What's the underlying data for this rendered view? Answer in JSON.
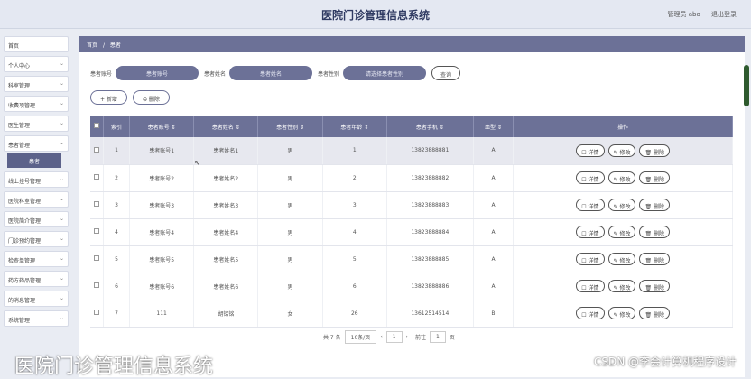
{
  "app": {
    "title": "医院门诊管理信息系统",
    "admin_label": "管理员 abo",
    "logout_label": "退出登录"
  },
  "sidebar": {
    "items": [
      {
        "label": "首页"
      },
      {
        "label": "个人中心"
      },
      {
        "label": "科室管理"
      },
      {
        "label": "收费项管理"
      },
      {
        "label": "医生管理"
      },
      {
        "label": "患者管理"
      },
      {
        "label": "线上挂号管理"
      },
      {
        "label": "医院科室管理"
      },
      {
        "label": "医院简介管理"
      },
      {
        "label": "门诊预约管理"
      },
      {
        "label": "检查单管理"
      },
      {
        "label": "药方药品管理"
      },
      {
        "label": "的消息管理"
      },
      {
        "label": "系统管理"
      }
    ],
    "active_sub": "患者"
  },
  "breadcrumb": {
    "home": "首页",
    "sep": "/",
    "current": "患者"
  },
  "filters": {
    "account_label": "患者账号",
    "account_placeholder": "患者账号",
    "name_label": "患者姓名",
    "name_placeholder": "患者姓名",
    "gender_label": "患者性别",
    "gender_placeholder": "请选择患者性别",
    "query_label": "查询"
  },
  "actions": {
    "add_label": "+ 新增",
    "delete_label": "⊖ 删除"
  },
  "table": {
    "headers": [
      "",
      "索引",
      "患者账号 ⇕",
      "患者姓名 ⇕",
      "患者性别 ⇕",
      "患者年龄 ⇕",
      "患者手机 ⇕",
      "血型 ⇕",
      "操作"
    ],
    "rows": [
      [
        "1",
        "患者账号1",
        "患者姓名1",
        "男",
        "1",
        "13823888881",
        "A"
      ],
      [
        "2",
        "患者账号2",
        "患者姓名2",
        "男",
        "2",
        "13823888882",
        "A"
      ],
      [
        "3",
        "患者账号3",
        "患者姓名3",
        "男",
        "3",
        "13823888883",
        "A"
      ],
      [
        "4",
        "患者账号4",
        "患者姓名4",
        "男",
        "4",
        "13823888884",
        "A"
      ],
      [
        "5",
        "患者账号5",
        "患者姓名5",
        "男",
        "5",
        "13823888885",
        "A"
      ],
      [
        "6",
        "患者账号6",
        "患者姓名6",
        "男",
        "6",
        "13823888886",
        "A"
      ],
      [
        "7",
        "111",
        "胡铭铭",
        "女",
        "26",
        "13612514514",
        "B"
      ]
    ],
    "op_labels": [
      "详情",
      "修改",
      "删除"
    ]
  },
  "pager": {
    "total": "共 7 条",
    "per_page": "10条/页",
    "prev": "‹",
    "page": "1",
    "next": "›",
    "goto_label": "前往",
    "goto_value": "1",
    "page_suffix": "页"
  },
  "overlay": {
    "caption": "医院门诊管理信息系统",
    "watermark": "CSDN @李会计算机程序设计"
  }
}
